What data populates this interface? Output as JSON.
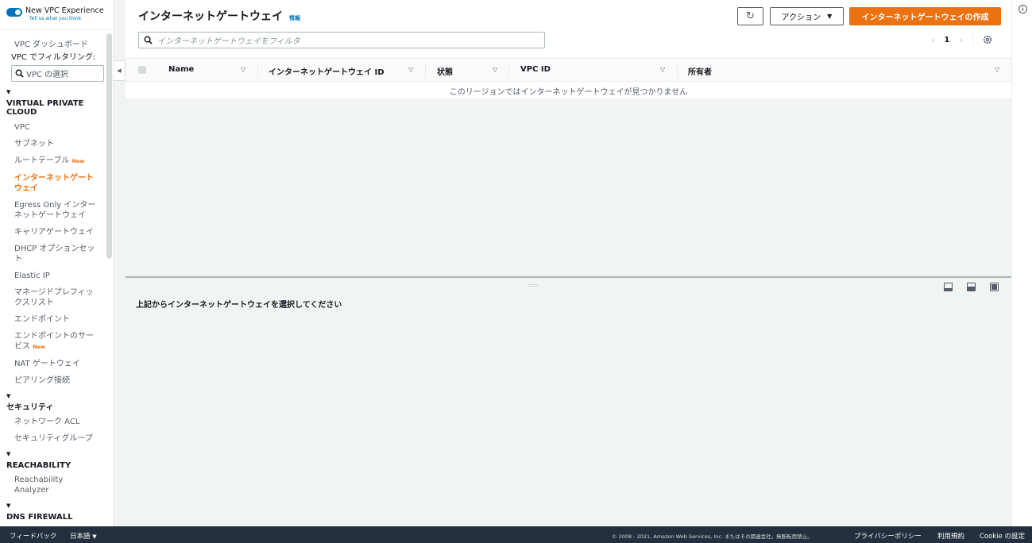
{
  "experience": {
    "title": "New VPC Experience",
    "link": "Tell us what you think"
  },
  "sidebar": {
    "dashboard": "VPC ダッシュボード",
    "filter_label": "VPC でフィルタリング:",
    "filter_placeholder": "VPC の選択",
    "sections": [
      {
        "title": "VIRTUAL PRIVATE CLOUD"
      },
      {
        "title": "セキュリティ"
      },
      {
        "title": "REACHABILITY"
      },
      {
        "title": "DNS FIREWALL"
      }
    ],
    "vpc_items": [
      {
        "label": "VPC"
      },
      {
        "label": "サブネット"
      },
      {
        "label": "ルートテーブル",
        "badge": "New"
      },
      {
        "label": "インターネットゲートウェイ",
        "active": true
      },
      {
        "label": "Egress Only インターネットゲートウェイ"
      },
      {
        "label": "キャリアゲートウェイ"
      },
      {
        "label": "DHCP オプションセット"
      },
      {
        "label": "Elastic IP"
      },
      {
        "label": "マネージドプレフィックスリスト"
      },
      {
        "label": "エンドポイント"
      },
      {
        "label": "エンドポイントのサービス",
        "badge": "New"
      },
      {
        "label": "NAT ゲートウェイ"
      },
      {
        "label": "ピアリング接続"
      }
    ],
    "security_items": [
      {
        "label": "ネットワーク ACL"
      },
      {
        "label": "セキュリティグループ"
      }
    ],
    "reachability_items": [
      {
        "label": "Reachability Analyzer"
      }
    ]
  },
  "header": {
    "title": "インターネットゲートウェイ",
    "info": "情報",
    "actions_label": "アクション",
    "create_label": "インターネットゲートウェイの作成"
  },
  "filter": {
    "placeholder": "インターネットゲートウェイをフィルタ"
  },
  "pagination": {
    "page": "1"
  },
  "table": {
    "columns": [
      "Name",
      "インターネットゲートウェイ ID",
      "状態",
      "VPC ID",
      "所有者"
    ],
    "empty_message": "このリージョンではインターネットゲートウェイが見つかりません"
  },
  "detail": {
    "message": "上記からインターネットゲートウェイを選択してください"
  },
  "footer": {
    "feedback": "フィードバック",
    "language": "日本語",
    "copyright": "© 2008 - 2021, Amazon Web Services, Inc. またはその関連会社。無断転用禁止。",
    "privacy": "プライバシーポリシー",
    "terms": "利用規約",
    "cookie": "Cookie の設定"
  },
  "colors": {
    "accent": "#ec7211",
    "link": "#0073bb",
    "footer_bg": "#232f3e"
  }
}
